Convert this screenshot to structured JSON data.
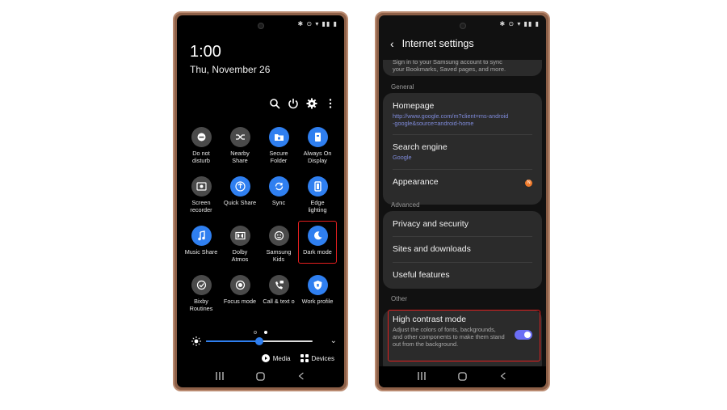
{
  "colors": {
    "accent_blue": "#2f7ff0",
    "highlight_red": "#e31f1f",
    "link_purple": "#7f8bdb",
    "badge_orange": "#f07a2b",
    "phone_bronze": "#8d6048"
  },
  "left_phone": {
    "time": "1:00",
    "date": "Thu, November 26",
    "toolbar_icons": [
      "search-icon",
      "power-icon",
      "gear-icon",
      "more-vert-icon"
    ],
    "tiles": [
      {
        "label": "Do not\ndisturb",
        "icon": "minus-circle-icon",
        "on": false
      },
      {
        "label": "Nearby\nShare",
        "icon": "nearby-share-icon",
        "on": false
      },
      {
        "label": "Secure\nFolder",
        "icon": "folder-icon",
        "on": true
      },
      {
        "label": "Always On\nDisplay",
        "icon": "clock-screen-icon",
        "on": true
      },
      {
        "label": "Screen\nrecorder",
        "icon": "screen-record-icon",
        "on": false
      },
      {
        "label": "Quick Share",
        "icon": "share-icon",
        "on": true
      },
      {
        "label": "Sync",
        "icon": "sync-icon",
        "on": true
      },
      {
        "label": "Edge\nlighting",
        "icon": "edge-lighting-icon",
        "on": true
      },
      {
        "label": "Music Share",
        "icon": "music-note-icon",
        "on": true
      },
      {
        "label": "Dolby\nAtmos",
        "icon": "dolby-icon",
        "on": false
      },
      {
        "label": "Samsung\nKids",
        "icon": "kids-icon",
        "on": false
      },
      {
        "label": "Dark mode",
        "icon": "moon-icon",
        "on": true,
        "highlighted": true
      },
      {
        "label": "Bixby\nRoutines",
        "icon": "check-circle-icon",
        "on": false
      },
      {
        "label": "Focus mode",
        "icon": "focus-icon",
        "on": false
      },
      {
        "label": "Call & text o",
        "icon": "call-text-icon",
        "on": false
      },
      {
        "label": "Work profile",
        "icon": "shield-icon",
        "on": true
      }
    ],
    "brightness_level": 0.5,
    "media_label": "Media",
    "devices_label": "Devices"
  },
  "right_phone": {
    "title": "Internet settings",
    "cut_text_line1": "Sign in to your Samsung account to sync",
    "cut_text_line2": "your Bookmarks, Saved pages, and more.",
    "section_general": "General",
    "homepage_title": "Homepage",
    "homepage_url_line1": "http://www.google.com/m?client=ms-android",
    "homepage_url_line2": "-google&source=android-home",
    "search_engine_title": "Search engine",
    "search_engine_value": "Google",
    "appearance_title": "Appearance",
    "appearance_badge": "N",
    "section_advanced": "Advanced",
    "privacy_title": "Privacy and security",
    "sites_title": "Sites and downloads",
    "useful_title": "Useful features",
    "section_other": "Other",
    "hc_title": "High contrast mode",
    "hc_desc": "Adjust the colors of fonts, backgrounds, and other components to make them stand out from the background.",
    "hc_enabled": true
  }
}
